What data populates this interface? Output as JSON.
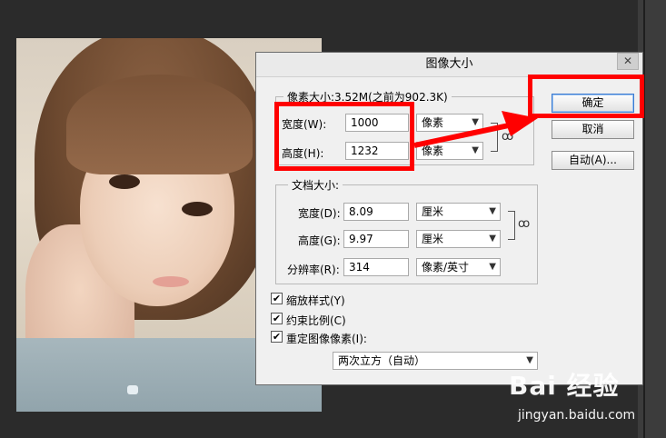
{
  "dialog": {
    "title": "图像大小",
    "close_glyph": "✕",
    "pixel_group": {
      "title": "像素大小:3.52M(之前为902.3K)",
      "width_label": "宽度(W):",
      "width_value": "1000",
      "width_unit": "像素",
      "height_label": "高度(H):",
      "height_value": "1232",
      "height_unit": "像素"
    },
    "doc_group": {
      "title": "文档大小:",
      "width_label": "宽度(D):",
      "width_value": "8.09",
      "width_unit": "厘米",
      "height_label": "高度(G):",
      "height_value": "9.97",
      "height_unit": "厘米",
      "res_label": "分辨率(R):",
      "res_value": "314",
      "res_unit": "像素/英寸"
    },
    "buttons": {
      "ok": "确定",
      "cancel": "取消",
      "auto": "自动(A)..."
    },
    "options": {
      "scale_styles": "缩放样式(Y)",
      "constrain": "约束比例(C)",
      "resample": "重定图像像素(I):",
      "resample_method": "两次立方（自动）"
    }
  },
  "watermark": {
    "logo": "Bai 经验",
    "url": "jingyan.baidu.com"
  },
  "colors": {
    "annotation": "#ff0000",
    "background": "#2b2b2b",
    "dialog": "#f0f0f0"
  }
}
